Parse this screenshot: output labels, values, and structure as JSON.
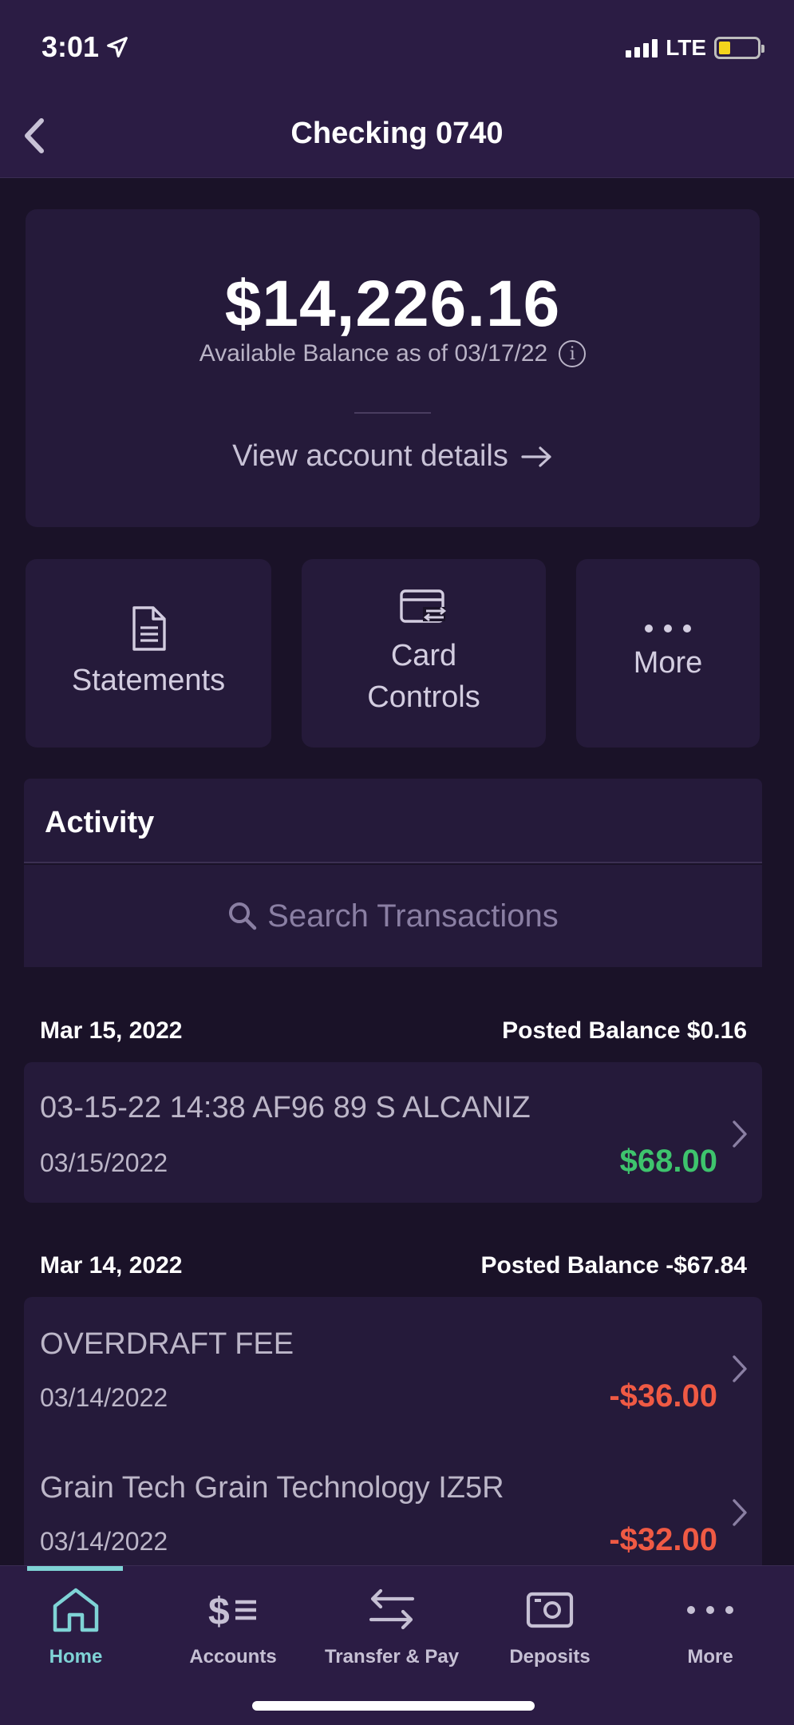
{
  "status": {
    "time": "3:01",
    "network": "LTE"
  },
  "header": {
    "title": "Checking 0740"
  },
  "balance": {
    "amount": "$14,226.16",
    "subtitle": "Available Balance as of 03/17/22",
    "details_link": "View account details"
  },
  "actions": [
    {
      "label": "Statements"
    },
    {
      "label": "Card Controls"
    },
    {
      "label": "More"
    }
  ],
  "activity": {
    "title": "Activity",
    "search_placeholder": "Search Transactions",
    "groups": [
      {
        "date": "Mar 15, 2022",
        "posted_balance": "Posted Balance $0.16",
        "transactions": [
          {
            "description": "03-15-22 14:38 AF96 89 S ALCANIZ",
            "date": "03/15/2022",
            "amount": "$68.00",
            "type": "credit"
          }
        ]
      },
      {
        "date": "Mar 14, 2022",
        "posted_balance": "Posted Balance -$67.84",
        "transactions": [
          {
            "description": "OVERDRAFT FEE",
            "date": "03/14/2022",
            "amount": "-$36.00",
            "type": "debit"
          },
          {
            "description": "Grain Tech Grain Technology IZ5R",
            "date": "03/14/2022",
            "amount": "-$32.00",
            "type": "debit"
          }
        ]
      }
    ]
  },
  "nav": {
    "items": [
      {
        "label": "Home",
        "icon": "home-icon",
        "active": true
      },
      {
        "label": "Accounts",
        "icon": "accounts-icon"
      },
      {
        "label": "Transfer & Pay",
        "icon": "transfer-icon"
      },
      {
        "label": "Deposits",
        "icon": "deposit-icon"
      },
      {
        "label": "More",
        "icon": "more-icon"
      }
    ]
  },
  "colors": {
    "background": "#1a1228",
    "card": "#251a3a",
    "header": "#2b1c44",
    "credit": "#3ec46d",
    "debit": "#ef5a44",
    "accent": "#7fd3d6"
  }
}
